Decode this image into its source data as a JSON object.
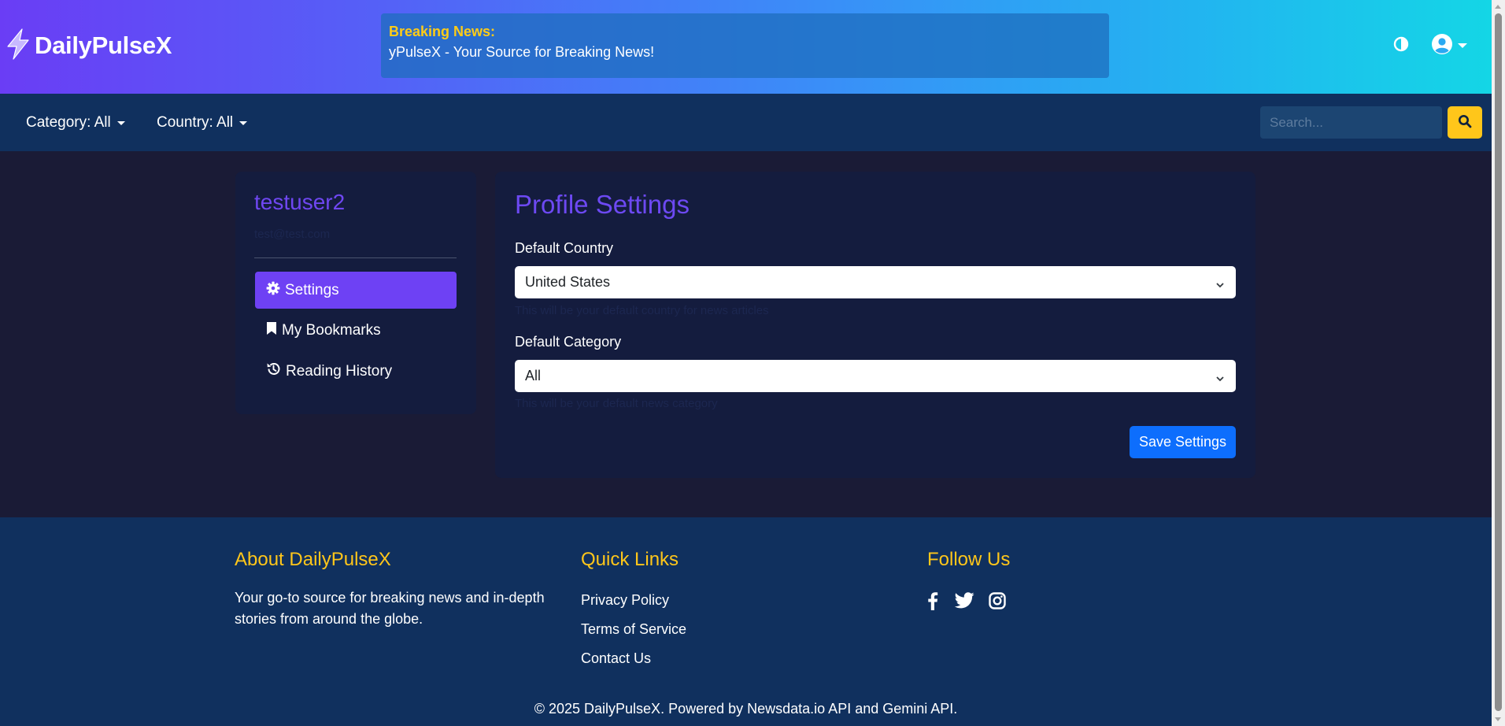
{
  "header": {
    "brand": "DailyPulseX",
    "ticker_label": "Breaking News:",
    "ticker_text": "yPulseX - Your Source for Breaking News!"
  },
  "navbar": {
    "category_label": "Category: All",
    "country_label": "Country: All",
    "search_placeholder": "Search..."
  },
  "sidebar": {
    "username": "testuser2",
    "email": "test@test.com",
    "items": [
      {
        "label": "Settings",
        "icon": "gear-icon",
        "active": true
      },
      {
        "label": "My Bookmarks",
        "icon": "bookmark-icon",
        "active": false
      },
      {
        "label": "Reading History",
        "icon": "history-icon",
        "active": false
      }
    ]
  },
  "settings": {
    "title": "Profile Settings",
    "country_label": "Default Country",
    "country_value": "United States",
    "country_help": "This will be your default country for news articles",
    "category_label": "Default Category",
    "category_value": "All",
    "category_help": "This will be your default news category",
    "save_label": "Save Settings"
  },
  "footer": {
    "about_heading": "About DailyPulseX",
    "about_text": "Your go-to source for breaking news and in-depth stories from around the globe.",
    "links_heading": "Quick Links",
    "links": [
      "Privacy Policy",
      "Terms of Service",
      "Contact Us"
    ],
    "follow_heading": "Follow Us",
    "social": [
      "facebook-icon",
      "twitter-icon",
      "instagram-icon"
    ],
    "copyright": "© 2025 DailyPulseX. Powered by Newsdata.io API and Gemini API."
  },
  "colors": {
    "accent_purple": "#6e41f4",
    "accent_yellow": "#ffc61a",
    "primary_blue": "#0d6efd",
    "navbar_bg": "#10305e",
    "card_bg": "#141c3e"
  }
}
